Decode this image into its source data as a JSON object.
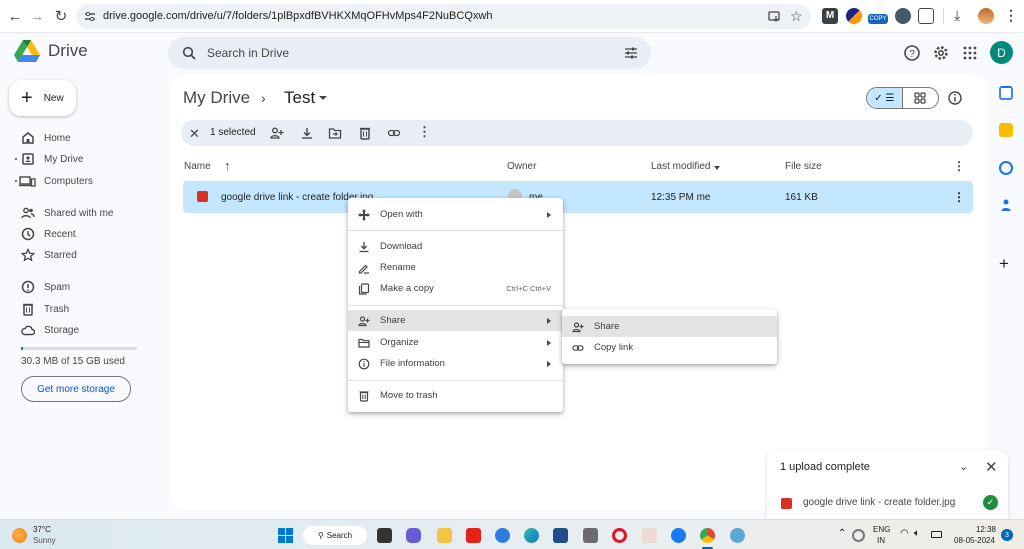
{
  "browser": {
    "url": "drive.google.com/drive/u/7/folders/1plBpxdfBVHKXMqOFHvMps4F2NuBCQxwh",
    "extension_badge": "COPY",
    "icons": [
      "back-icon",
      "forward-icon",
      "reload-icon",
      "site-info-icon",
      "install-app-icon",
      "bookmark-star-icon",
      "extension-m-icon",
      "extension-circle-icon",
      "extension-copy-icon",
      "extension-dark-icon",
      "extensions-puzzle-icon",
      "downloads-icon",
      "profile-avatar",
      "menu-kebab-icon"
    ]
  },
  "header": {
    "app_name": "Drive",
    "search_placeholder": "Search in Drive",
    "avatar_letter": "D"
  },
  "sidebar": {
    "new_label": "New",
    "items": [
      {
        "label": "Home",
        "icon": "home-icon"
      },
      {
        "label": "My Drive",
        "icon": "my-drive-icon"
      },
      {
        "label": "Computers",
        "icon": "computers-icon"
      },
      {
        "label": "Shared with me",
        "icon": "shared-icon"
      },
      {
        "label": "Recent",
        "icon": "clock-icon"
      },
      {
        "label": "Starred",
        "icon": "star-icon"
      },
      {
        "label": "Spam",
        "icon": "spam-icon"
      },
      {
        "label": "Trash",
        "icon": "trash-icon"
      },
      {
        "label": "Storage",
        "icon": "cloud-icon"
      }
    ],
    "storage_used_text": "30.3 MB of 15 GB used",
    "storage_used_fraction": 0.002,
    "get_more_storage": "Get more storage"
  },
  "breadcrumb": {
    "root": "My Drive",
    "separator": "›",
    "current": "Test"
  },
  "selection_bar": {
    "count_label": "1 selected",
    "actions": [
      "share",
      "download",
      "move",
      "trash",
      "copy-link",
      "more"
    ]
  },
  "table": {
    "headers": {
      "name": "Name",
      "owner": "Owner",
      "last_modified": "Last modified",
      "file_size": "File size"
    },
    "rows": [
      {
        "name": "google drive link - create folder.jpg",
        "owner": "me",
        "modified": "12:35 PM me",
        "size": "161 KB",
        "selected": true
      }
    ]
  },
  "context_menu": {
    "items": [
      {
        "label": "Open with",
        "icon": "open-with-icon",
        "submenu": true
      },
      {
        "label": "Download",
        "icon": "download-icon"
      },
      {
        "label": "Rename",
        "icon": "rename-icon"
      },
      {
        "label": "Make a copy",
        "icon": "copy-icon",
        "shortcut": "Ctrl+C Ctrl+V"
      },
      {
        "label": "Share",
        "icon": "share-icon",
        "submenu": true,
        "highlighted": true
      },
      {
        "label": "Organize",
        "icon": "folder-icon",
        "submenu": true
      },
      {
        "label": "File information",
        "icon": "info-icon",
        "submenu": true
      },
      {
        "label": "Move to trash",
        "icon": "trash-icon"
      }
    ],
    "submenu": [
      {
        "label": "Share",
        "icon": "share-icon",
        "highlighted": true
      },
      {
        "label": "Copy link",
        "icon": "link-icon"
      }
    ]
  },
  "upload_panel": {
    "title": "1 upload complete",
    "file": "google drive link - create folder.jpg",
    "status": "complete"
  },
  "taskbar": {
    "temperature": "37°C",
    "condition": "Sunny",
    "search_label": "Search",
    "lang_line1": "ENG",
    "lang_line2": "IN",
    "time": "12:38",
    "date": "08-05-2024",
    "notification_count": "3"
  },
  "colors": {
    "accent": "#0b57d0",
    "selected_row": "#c2e7ff",
    "avatar": "#00897b",
    "success": "#1e8e3e",
    "image_file": "#d93025"
  }
}
